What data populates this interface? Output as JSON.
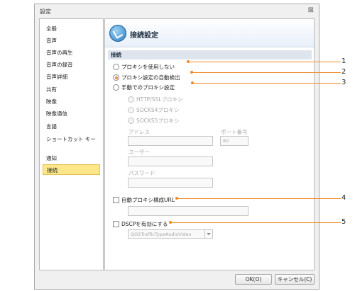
{
  "window": {
    "title": "設定",
    "close_icon": "⊠"
  },
  "sidebar": {
    "items": [
      {
        "label": "全般"
      },
      {
        "label": "音声"
      },
      {
        "label": "音声の再生"
      },
      {
        "label": "音声の録音"
      },
      {
        "label": "音声詳細"
      },
      {
        "label": "共有"
      },
      {
        "label": "映像"
      },
      {
        "label": "映像通信"
      },
      {
        "label": "言語"
      },
      {
        "label": "ショートカット キー"
      },
      {
        "label": "通知"
      },
      {
        "label": "接続",
        "selected": true
      }
    ]
  },
  "panel": {
    "title": "接続設定",
    "icon": "connection-icon",
    "group": "接続",
    "proxy": {
      "no_proxy": "プロキシを使用しない",
      "auto_detect": "プロキシ設定の自動検出",
      "manual": "手動でのプロキシ設定",
      "selected": "auto_detect",
      "types": [
        "HTTP/SSLプロキシ",
        "SOCKS4プロキシ",
        "SOCKS5プロキシ"
      ],
      "address_label": "アドレス",
      "port_label": "ポート番号",
      "port_value": "80",
      "user_label": "ユーザー",
      "password_label": "パスワード"
    },
    "auto_config_label": "自動プロキシ構成URL",
    "dscp_label": "DSCPを有効にする",
    "dscp_value": "QOSTrafficTypeAudioVideo"
  },
  "buttons": {
    "ok": "OK(O)",
    "cancel": "キャンセル(C)"
  },
  "callouts": [
    "1",
    "2",
    "3",
    "4",
    "5"
  ],
  "colors": {
    "accent": "#f08a24",
    "selected": "#fde78a"
  }
}
